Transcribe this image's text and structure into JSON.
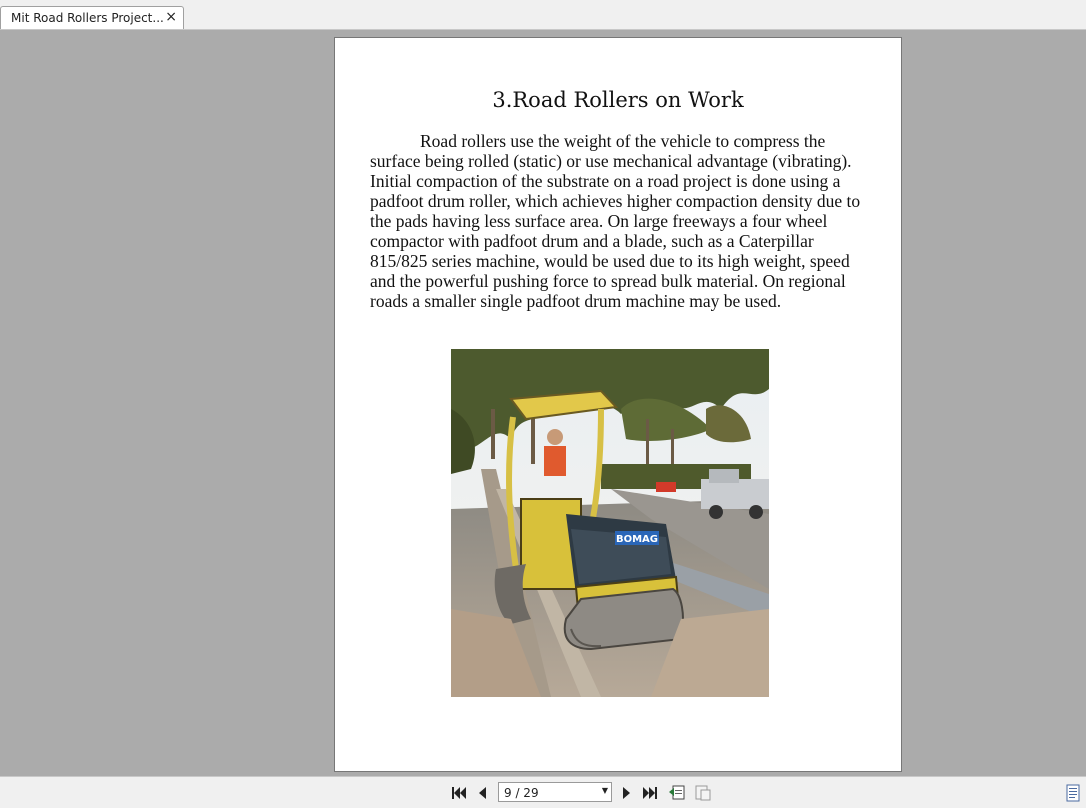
{
  "tab": {
    "title": "Mit Road Rollers Project...",
    "close": "×"
  },
  "document": {
    "title": "3.Road Rollers on Work",
    "body": "Road rollers use the weight of the vehicle to compress the surface being rolled (static) or use mechanical advantage (vibrating). Initial compaction of the substrate on a road project is done using a padfoot drum roller, which achieves higher compaction density due to the pads having less surface area. On large freeways a four wheel compactor with padfoot drum and a blade, such as a Caterpillar 815/825 series machine, would be used due to its high weight, speed and the powerful pushing force to spread bulk material. On regional roads a smaller single padfoot drum machine may be used.",
    "photo_text": "BOMAG"
  },
  "navigation": {
    "page_indicator": "9 / 29",
    "icons": [
      "first-page-icon",
      "previous-page-icon",
      "next-page-icon",
      "last-page-icon",
      "go-back-icon",
      "go-forward-icon",
      "page-view-icon"
    ]
  }
}
